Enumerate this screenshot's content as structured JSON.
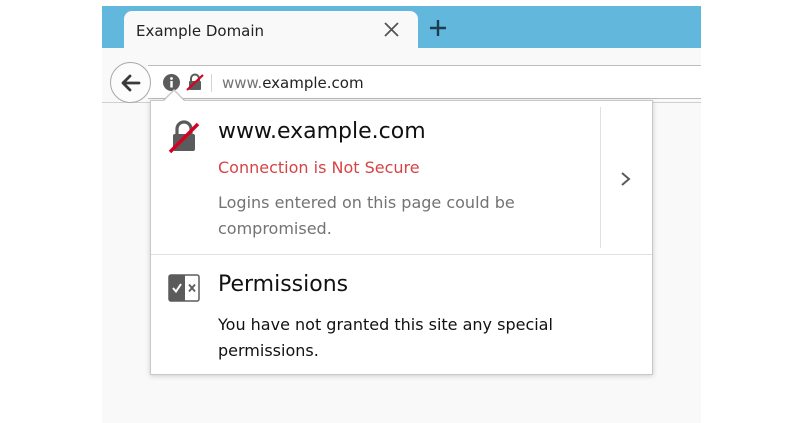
{
  "tab": {
    "title": "Example Domain"
  },
  "url": {
    "prefix": "www.",
    "domain": "example.com"
  },
  "site_panel": {
    "host": "www.example.com",
    "connection_status": "Connection is Not Secure",
    "connection_description": "Logins entered on this page could be compromised.",
    "status_color": "#d74345"
  },
  "permissions": {
    "title": "Permissions",
    "description": "You have not granted this site any special permissions."
  },
  "icons": {
    "tab_close": "close-icon",
    "new_tab": "plus-icon",
    "back": "back-arrow-icon",
    "info": "info-icon",
    "insecure": "insecure-lock-icon",
    "expand": "chevron-right-icon",
    "permissions": "permissions-icon"
  },
  "colors": {
    "tabstrip": "#61b8dc",
    "toolbar": "#f9f9fa"
  }
}
